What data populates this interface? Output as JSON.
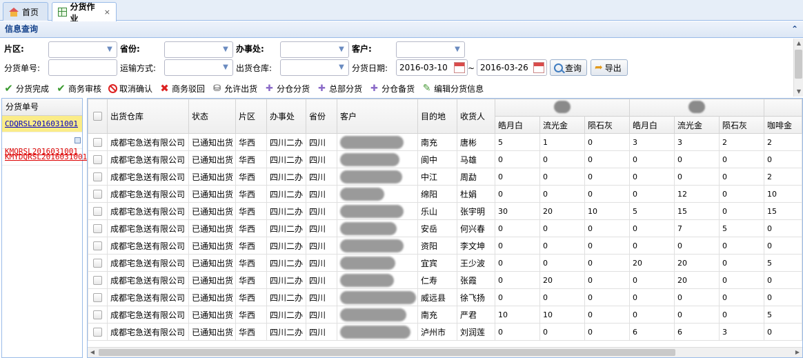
{
  "tabs": [
    {
      "label": "首页"
    },
    {
      "label": "分货作业",
      "close": "×"
    }
  ],
  "panel": {
    "title": "信息查询"
  },
  "form": {
    "area_label": "片区:",
    "province_label": "省份:",
    "office_label": "办事处:",
    "customer_label": "客户:",
    "order_no_label": "分货单号:",
    "transport_label": "运输方式:",
    "warehouse_label": "出货仓库:",
    "date_label": "分货日期:",
    "date_from": "2016-03-10",
    "date_sep": "~",
    "date_to": "2016-03-26",
    "query_button": "查询",
    "export_button": "导出"
  },
  "toolbar": [
    {
      "label": "分货完成",
      "icon": "check-icon"
    },
    {
      "label": "商务审核",
      "icon": "check-icon"
    },
    {
      "label": "取消确认",
      "icon": "cancel-icon"
    },
    {
      "label": "商务驳回",
      "icon": "reject-icon"
    },
    {
      "label": "允许出货",
      "icon": "database-icon"
    },
    {
      "label": "分仓分货",
      "icon": "move-icon"
    },
    {
      "label": "总部分货",
      "icon": "move-icon"
    },
    {
      "label": "分仓备货",
      "icon": "move-icon"
    },
    {
      "label": "编辑分货信息",
      "icon": "pencil-icon"
    }
  ],
  "left_list": {
    "header": "分货单号",
    "items": [
      {
        "label": "CDQRSL2016031001",
        "state": "selected"
      },
      {
        "label": "KMQRSL2016031001",
        "state": "red"
      },
      {
        "label": "KMYDQRSL2016031001",
        "state": "red"
      }
    ]
  },
  "grid": {
    "columns": [
      "出货仓库",
      "状态",
      "片区",
      "办事处",
      "省份",
      "客户",
      "目的地",
      "收货人"
    ],
    "sub_columns": [
      "皓月白",
      "流光金",
      "陨石灰",
      "皓月白",
      "流光金",
      "陨石灰",
      "咖啡金"
    ],
    "rows": [
      {
        "warehouse": "成都宅急送有限公司",
        "status": "已通知出货",
        "area": "华西",
        "office": "四川二办",
        "province": "四川",
        "dest": "南充",
        "receiver": "唐彬",
        "vals": [
          "5",
          "1",
          "0",
          "3",
          "3",
          "2",
          "2"
        ]
      },
      {
        "warehouse": "成都宅急送有限公司",
        "status": "已通知出货",
        "area": "华西",
        "office": "四川二办",
        "province": "四川",
        "dest": "阆中",
        "receiver": "马雄",
        "vals": [
          "0",
          "0",
          "0",
          "0",
          "0",
          "0",
          "0"
        ]
      },
      {
        "warehouse": "成都宅急送有限公司",
        "status": "已通知出货",
        "area": "华西",
        "office": "四川二办",
        "province": "四川",
        "dest": "中江",
        "receiver": "周勐",
        "vals": [
          "0",
          "0",
          "0",
          "0",
          "0",
          "0",
          "2"
        ]
      },
      {
        "warehouse": "成都宅急送有限公司",
        "status": "已通知出货",
        "area": "华西",
        "office": "四川二办",
        "province": "四川",
        "dest": "绵阳",
        "receiver": "杜娟",
        "vals": [
          "0",
          "0",
          "0",
          "0",
          "12",
          "0",
          "10"
        ]
      },
      {
        "warehouse": "成都宅急送有限公司",
        "status": "已通知出货",
        "area": "华西",
        "office": "四川二办",
        "province": "四川",
        "dest": "乐山",
        "receiver": "张宇明",
        "vals": [
          "30",
          "20",
          "10",
          "5",
          "15",
          "0",
          "15"
        ]
      },
      {
        "warehouse": "成都宅急送有限公司",
        "status": "已通知出货",
        "area": "华西",
        "office": "四川二办",
        "province": "四川",
        "dest": "安岳",
        "receiver": "何兴春",
        "vals": [
          "0",
          "0",
          "0",
          "0",
          "7",
          "5",
          "0"
        ]
      },
      {
        "warehouse": "成都宅急送有限公司",
        "status": "已通知出货",
        "area": "华西",
        "office": "四川二办",
        "province": "四川",
        "dest": "资阳",
        "receiver": "李文坤",
        "vals": [
          "0",
          "0",
          "0",
          "0",
          "0",
          "0",
          "0"
        ]
      },
      {
        "warehouse": "成都宅急送有限公司",
        "status": "已通知出货",
        "area": "华西",
        "office": "四川二办",
        "province": "四川",
        "dest": "宜宾",
        "receiver": "王少波",
        "vals": [
          "0",
          "0",
          "0",
          "20",
          "20",
          "0",
          "5"
        ]
      },
      {
        "warehouse": "成都宅急送有限公司",
        "status": "已通知出货",
        "area": "华西",
        "office": "四川二办",
        "province": "四川",
        "dest": "仁寿",
        "receiver": "张霞",
        "vals": [
          "0",
          "20",
          "0",
          "0",
          "20",
          "0",
          "0"
        ]
      },
      {
        "warehouse": "成都宅急送有限公司",
        "status": "已通知出货",
        "area": "华西",
        "office": "四川二办",
        "province": "四川",
        "dest": "威远县",
        "receiver": "徐飞扬",
        "vals": [
          "0",
          "0",
          "0",
          "0",
          "0",
          "0",
          "0"
        ]
      },
      {
        "warehouse": "成都宅急送有限公司",
        "status": "已通知出货",
        "area": "华西",
        "office": "四川二办",
        "province": "四川",
        "dest": "南充",
        "receiver": "严君",
        "vals": [
          "10",
          "10",
          "0",
          "0",
          "0",
          "0",
          "5"
        ]
      },
      {
        "warehouse": "成都宅急送有限公司",
        "status": "已通知出货",
        "area": "华西",
        "office": "四川二办",
        "province": "四川",
        "dest": "泸州市",
        "receiver": "刘润莲",
        "vals": [
          "0",
          "0",
          "0",
          "6",
          "6",
          "3",
          "0"
        ]
      }
    ]
  },
  "colors": {
    "accent": "#15428b",
    "border": "#99bbe8",
    "selected": "#fbec88"
  }
}
